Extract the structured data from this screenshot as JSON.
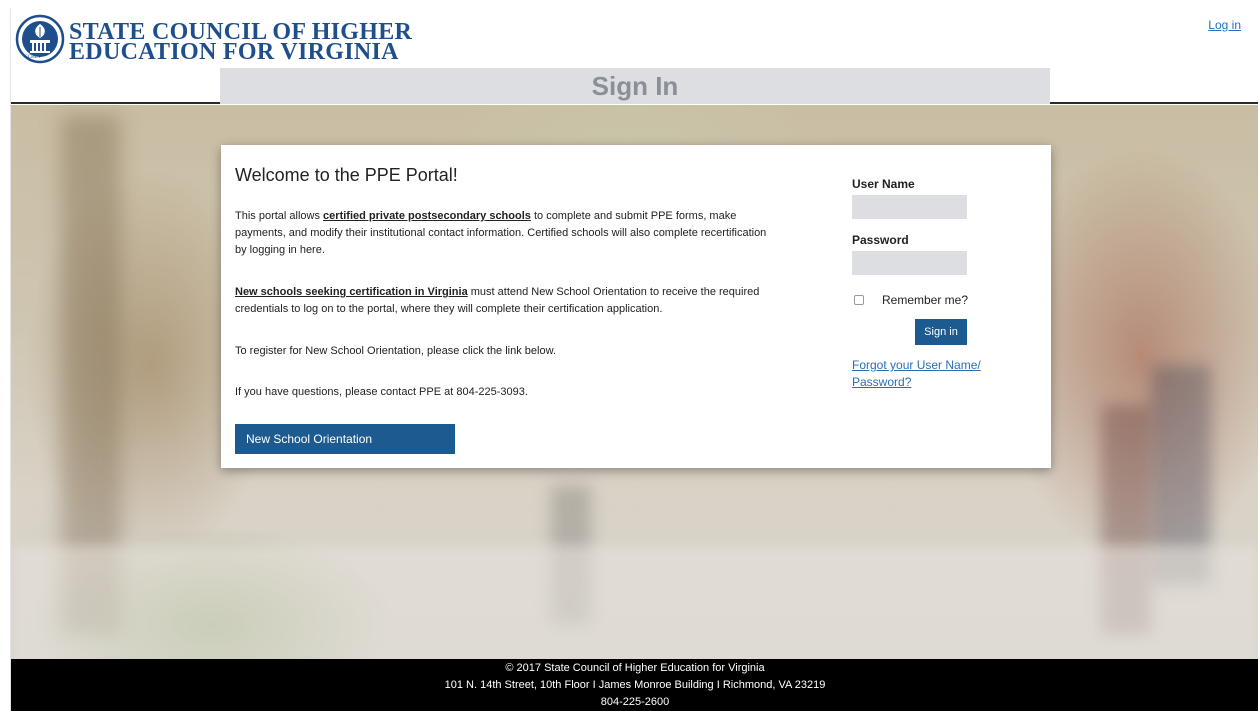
{
  "header": {
    "logo_line1": "STATE COUNCIL OF HIGHER",
    "logo_line2": "EDUCATION FOR VIRGINIA",
    "seal_text": "SCHEV",
    "login_link": "Log in"
  },
  "signin_bar": {
    "title": "Sign In"
  },
  "card": {
    "welcome": "Welcome to the PPE Portal!",
    "p1_pre": "This portal allows ",
    "p1_link": "certified private postsecondary schools",
    "p1_post": " to complete and submit PPE forms, make payments, and modify their institutional contact information. Certified schools will also complete recertification by logging in here.",
    "p2_link": "New schools seeking certification in Virginia",
    "p2_post": " must attend New School Orientation to receive the required credentials to log on to the portal, where they will complete their certification application.",
    "p3": "To register for New School Orientation, please click the link below.",
    "p4": "If you have questions, please contact PPE at 804-225-3093.",
    "nso_button": "New School Orientation"
  },
  "login_form": {
    "username_label": "User Name",
    "username_value": "",
    "password_label": "Password",
    "password_value": "",
    "remember_label": "Remember me?",
    "remember_checked": false,
    "signin_button": "Sign in",
    "forgot_link": "Forgot your User Name/ Password?"
  },
  "footer": {
    "line1": "© 2017 State Council of Higher Education for Virginia",
    "line2": "101 N. 14th Street, 10th Floor  I  James Monroe Building  I  Richmond, VA 23219",
    "line3": "804-225-2600"
  },
  "colors": {
    "brand_blue": "#1f4e8c",
    "button_blue": "#1c5a8f",
    "link_blue": "#2a6fb4",
    "signin_bar_gray": "#dcdee1"
  },
  "icons": {
    "seal": "schev-seal-icon",
    "checkbox": "checkbox-icon"
  }
}
